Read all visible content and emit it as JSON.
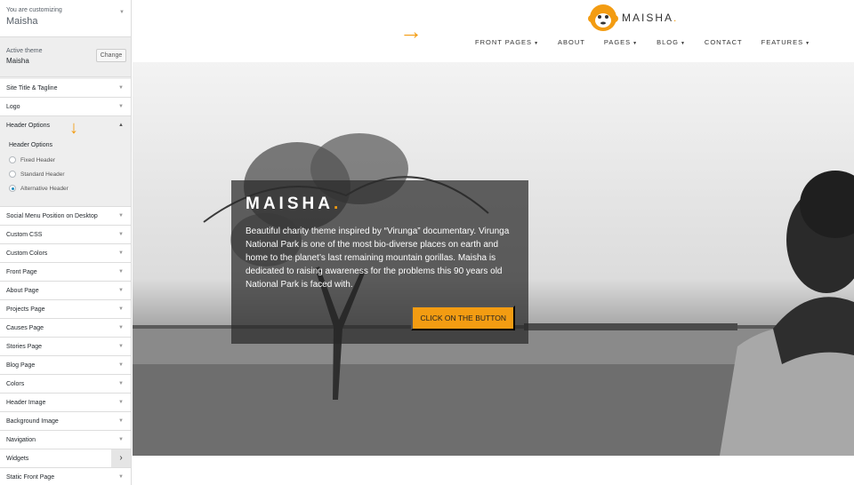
{
  "customizer": {
    "label": "You are customizing",
    "site": "Maisha",
    "active_theme_label": "Active theme",
    "active_theme_name": "Maisha",
    "change_label": "Change",
    "sections": {
      "site_title": "Site Title & Tagline",
      "logo": "Logo",
      "header_options": "Header Options",
      "social_menu": "Social Menu Position on Desktop",
      "custom_css": "Custom CSS",
      "custom_colors": "Custom Colors",
      "front_page": "Front Page",
      "about_page": "About Page",
      "projects_page": "Projects Page",
      "causes_page": "Causes Page",
      "stories_page": "Stories Page",
      "blog_page": "Blog Page",
      "colors": "Colors",
      "header_image": "Header Image",
      "background_image": "Background Image",
      "navigation": "Navigation",
      "widgets": "Widgets",
      "static_front_page": "Static Front Page"
    },
    "header_options_panel": {
      "title": "Header Options",
      "options": [
        "Fixed Header",
        "Standard Header",
        "Alternative Header"
      ],
      "selected": "Alternative Header"
    }
  },
  "site": {
    "logo_text": "MAISHA",
    "logo_dot": ".",
    "nav": {
      "front_pages": "FRONT PAGES",
      "about": "ABOUT",
      "pages": "PAGES",
      "blog": "BLOG",
      "contact": "CONTACT",
      "features": "FEATURES"
    },
    "hero": {
      "title": "MAISHA",
      "title_dot": ".",
      "text": "Beautiful charity theme inspired by “Virunga” documentary. Virunga National Park is one of the most bio-diverse places on earth and home to the planet’s last remaining mountain gorillas. Maisha is dedicated to raising awareness for the problems this 90 years old National Park is faced with.",
      "button": "CLICK ON THE BUTTON"
    }
  },
  "colors": {
    "accent": "#f39c12",
    "radio_checked": "#1e8cbe"
  },
  "icons": [
    "caret-down-icon",
    "caret-up-icon",
    "chevron-right-icon",
    "arrow-right-icon",
    "arrow-down-icon",
    "monkey-logo-icon"
  ]
}
